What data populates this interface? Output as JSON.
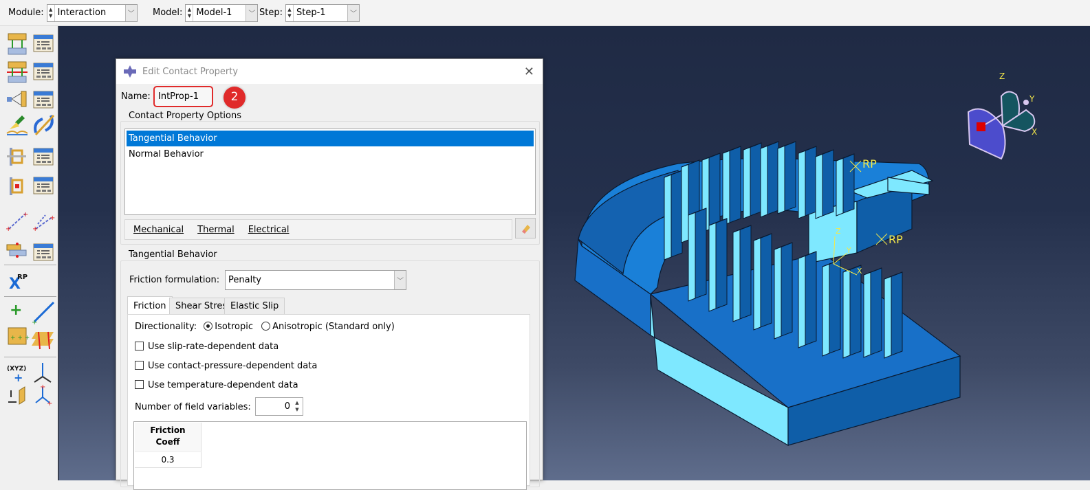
{
  "context_bar": {
    "module_label": "Module:",
    "module_value": "Interaction",
    "model_label": "Model:",
    "model_value": "Model-1",
    "step_label": "Step:",
    "step_value": "Step-1"
  },
  "toolbox": {
    "rp_icon_text": "RP",
    "rp_icon_mark": "X",
    "csys_icon_text": "(XYZ)"
  },
  "dialog": {
    "title": "Edit Contact Property",
    "name_label": "Name:",
    "name_value": "IntProp-1",
    "annotation_badge": "2",
    "options_group_label": "Contact Property Options",
    "options": [
      "Tangential Behavior",
      "Normal Behavior"
    ],
    "selected_option": "Tangential Behavior",
    "menus": [
      "Mechanical",
      "Thermal",
      "Electrical"
    ],
    "behavior_group_label": "Tangential Behavior",
    "friction_formulation_label": "Friction formulation:",
    "friction_formulation_value": "Penalty",
    "tabs": [
      "Friction",
      "Shear Stress",
      "Elastic Slip"
    ],
    "active_tab": "Friction",
    "directionality_label": "Directionality:",
    "directionality_options": [
      "Isotropic",
      "Anisotropic (Standard only)"
    ],
    "directionality_selected": "Isotropic",
    "checkboxes": [
      {
        "label": "Use slip-rate-dependent data",
        "checked": false
      },
      {
        "label": "Use contact-pressure-dependent data",
        "checked": false
      },
      {
        "label": "Use temperature-dependent data",
        "checked": false
      }
    ],
    "field_variables_label": "Number of field variables:",
    "field_variables_value": "0",
    "table": {
      "header": "Friction Coeff",
      "rows": [
        "0.3"
      ]
    }
  },
  "viewport": {
    "rp_labels": [
      "RP",
      "RP"
    ],
    "axis_labels": {
      "x": "X",
      "y": "Y",
      "z": "Z"
    },
    "colors": {
      "part_dark": "#0f5ea8",
      "part_mid": "#1a80d8",
      "part_light": "#7ee8ff",
      "highlight": "#e02a2a"
    }
  }
}
